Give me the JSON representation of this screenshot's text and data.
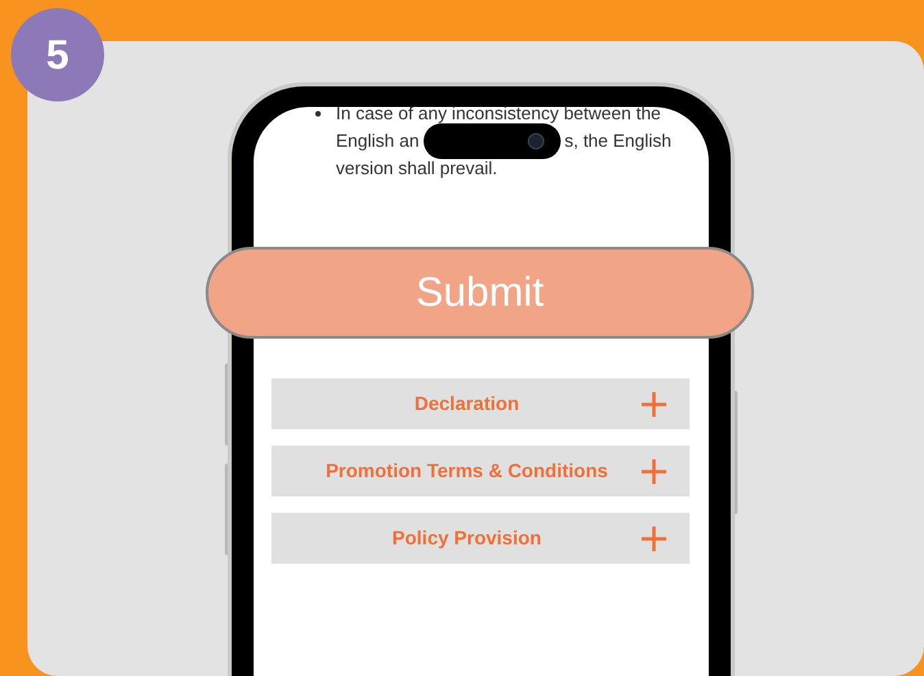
{
  "step_badge": "5",
  "notice": {
    "lines": [
      "In case of any inconsistency between the",
      "English an",
      "s, the English",
      "version shall prevail."
    ]
  },
  "submit_button": "Submit",
  "sections": [
    {
      "label": "Declaration",
      "expanded": false
    },
    {
      "label": "Promotion Terms & Conditions",
      "expanded": false
    },
    {
      "label": "Policy Provision",
      "expanded": false
    }
  ]
}
